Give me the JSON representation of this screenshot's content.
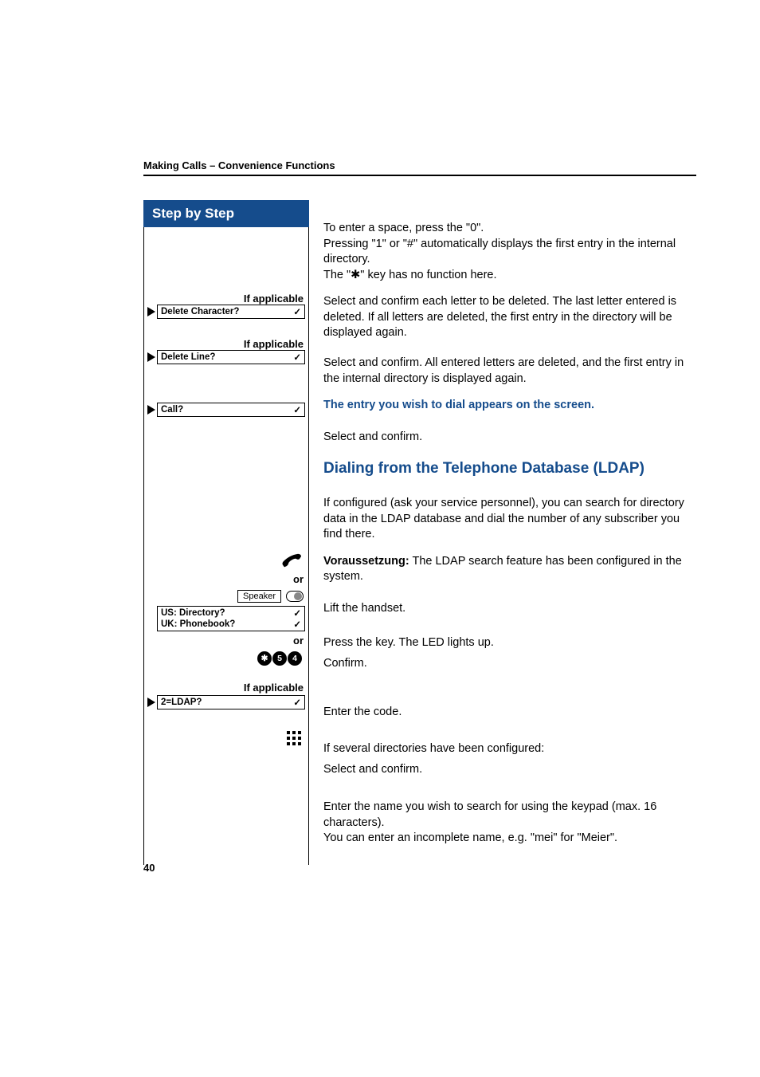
{
  "header": "Making Calls – Convenience Functions",
  "sidebar": {
    "title": "Step by Step",
    "if_applicable": "If applicable",
    "or": "or",
    "delete_char": "Delete Character?",
    "delete_line": "Delete Line?",
    "call": "Call?",
    "speaker": "Speaker",
    "us_directory": "US: Directory?",
    "uk_phonebook": "UK: Phonebook?",
    "ldap": "2=LDAP?",
    "code_keys": [
      "✱",
      "5",
      "4"
    ]
  },
  "body": {
    "p1": "To enter a space, press the \"0\".\nPressing \"1\" or \"#\" automatically displays the first entry in the internal directory.\nThe \"✱\" key has no function here.",
    "p2": "Select and confirm each letter to be deleted. The last letter entered is deleted. If all letters are deleted, the first entry in the directory will be displayed again.",
    "p3": "Select and confirm. All entered letters are deleted, and the first entry in the internal directory is displayed again.",
    "subhead": "The entry you wish to dial appears on the screen.",
    "p4": "Select and confirm.",
    "section": "Dialing from the Telephone Database (LDAP)",
    "p5": "If configured (ask your service personnel), you can search for directory data in the LDAP database and dial the number of any subscriber you find there.",
    "p6_label": "Voraussetzung:",
    "p6_rest": " The LDAP search feature has been configured in the system.",
    "p7": "Lift the handset.",
    "p8": "Press the key. The LED lights up.",
    "p9": "Confirm.",
    "p10": "Enter the code.",
    "p11": "If several directories have been configured:",
    "p12": "Select and confirm.",
    "p13": "Enter the name you wish to search for using the keypad (max. 16 characters).\nYou can enter an incomplete name, e.g. \"mei\" for \"Meier\"."
  },
  "page_number": "40"
}
